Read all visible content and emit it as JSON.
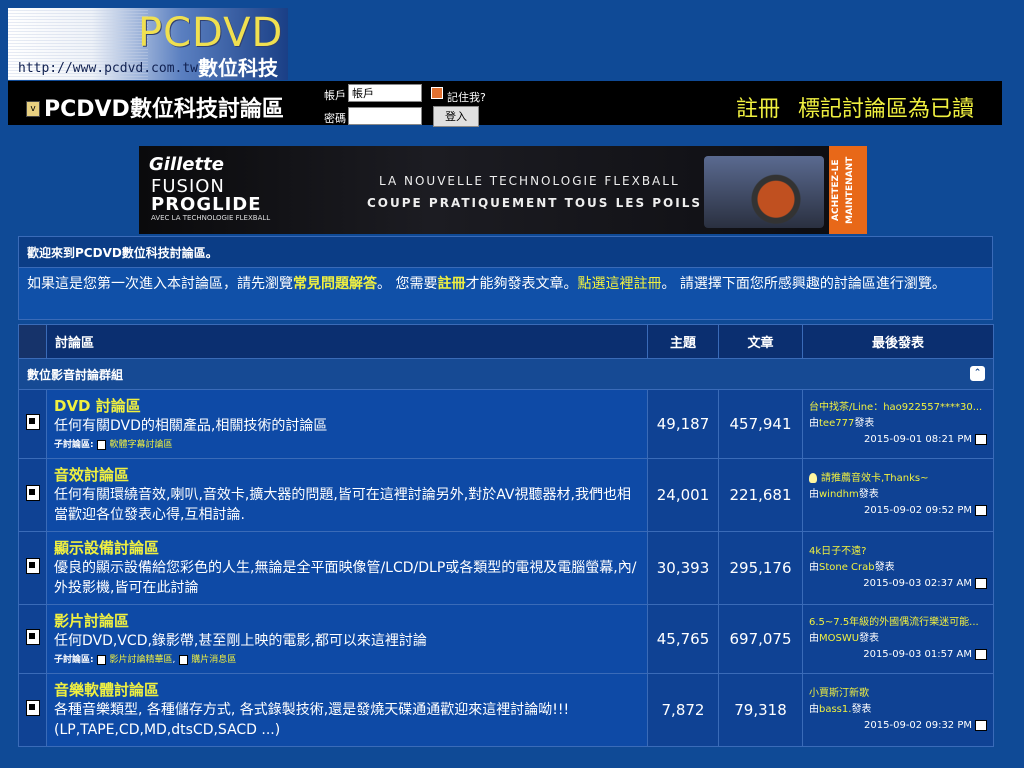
{
  "logo": {
    "brand": "PCDVD",
    "subtitle": "數位科技",
    "url": "http://www.pcdvd.com.tw"
  },
  "header": {
    "forum_title": "PCDVD數位科技討論區",
    "username_label": "帳戶",
    "username_value": "帳戶",
    "password_label": "密碼",
    "remember_label": "記住我?",
    "login_label": "登入",
    "register_link": "註冊",
    "mark_read_link": "標記討論區為已讀"
  },
  "ad": {
    "brand": "Gillette",
    "product_line1": "FUSION",
    "product_line2": "PROGLIDE",
    "product_line3": "AVEC LA TECHNOLOGIE FLEXBALL",
    "tagline1": "LA NOUVELLE TECHNOLOGIE FLEXBALL",
    "tagline2": "COUPE PRATIQUEMENT TOUS LES POILS",
    "cta": "ACHETEZ-LE MAINTENANT"
  },
  "welcome": {
    "heading": "歡迎來到PCDVD數位科技討論區。",
    "text_before_faq": "如果這是您第一次進入本討論區，請先瀏覽",
    "faq_link": "常見問題解答",
    "text_after_faq": "。 您需要",
    "register_link": "註冊",
    "text_after_register": "才能夠發表文章。",
    "register_click_link": "點選這裡註冊",
    "text_end": "。 請選擇下面您所感興趣的討論區進行瀏覽。"
  },
  "table": {
    "col_forum": "討論區",
    "col_threads": "主題",
    "col_posts": "文章",
    "col_last": "最後發表",
    "category": "數位影音討論群組",
    "subforum_label": "子討論區:",
    "by_prefix": "由",
    "by_suffix": "發表",
    "forums": [
      {
        "name": "DVD 討論區",
        "desc": "任何有關DVD的相關產品,相關技術的討論區",
        "subs": [
          "軟體字幕討論區"
        ],
        "threads": "49,187",
        "posts": "457,941",
        "last_title": "台中找茶/Line：hao922557****30...",
        "last_user": "tee777",
        "last_date": "2015-09-01",
        "last_time": "08:21 PM"
      },
      {
        "name": "音效討論區",
        "desc": "任何有關環繞音效,喇叭,音效卡,擴大器的問題,皆可在這裡討論另外,對於AV視聽器材,我們也相當歡迎各位發表心得,互相討論.",
        "subs": [],
        "threads": "24,001",
        "posts": "221,681",
        "last_title": "請推薦音效卡,Thanks~",
        "last_user": "windhm",
        "last_date": "2015-09-02",
        "last_time": "09:52 PM"
      },
      {
        "name": "顯示設備討論區",
        "desc": "優良的顯示設備給您彩色的人生,無論是全平面映像管/LCD/DLP或各類型的電視及電腦螢幕,內/外投影機,皆可在此討論",
        "subs": [],
        "threads": "30,393",
        "posts": "295,176",
        "last_title": "4k日子不遠?",
        "last_user": "Stone Crab",
        "last_date": "2015-09-03",
        "last_time": "02:37 AM"
      },
      {
        "name": "影片討論區",
        "desc": "任何DVD,VCD,錄影帶,甚至剛上映的電影,都可以來這裡討論",
        "subs": [
          "影片討論精華區",
          "購片消息區"
        ],
        "threads": "45,765",
        "posts": "697,075",
        "last_title": "6.5~7.5年級的外國偶流行樂迷可能...",
        "last_user": "MOSWU",
        "last_date": "2015-09-03",
        "last_time": "01:57 AM"
      },
      {
        "name": "音樂軟體討論區",
        "desc": "各種音樂類型, 各種儲存方式, 各式錄製技術,還是發燒天碟通通歡迎來這裡討論呦!!! (LP,TAPE,CD,MD,dtsCD,SACD ...)",
        "subs": [],
        "threads": "7,872",
        "posts": "79,318",
        "last_title": "小賈斯汀新歌",
        "last_user": "bass1.",
        "last_date": "2015-09-02",
        "last_time": "09:32 PM"
      }
    ]
  }
}
